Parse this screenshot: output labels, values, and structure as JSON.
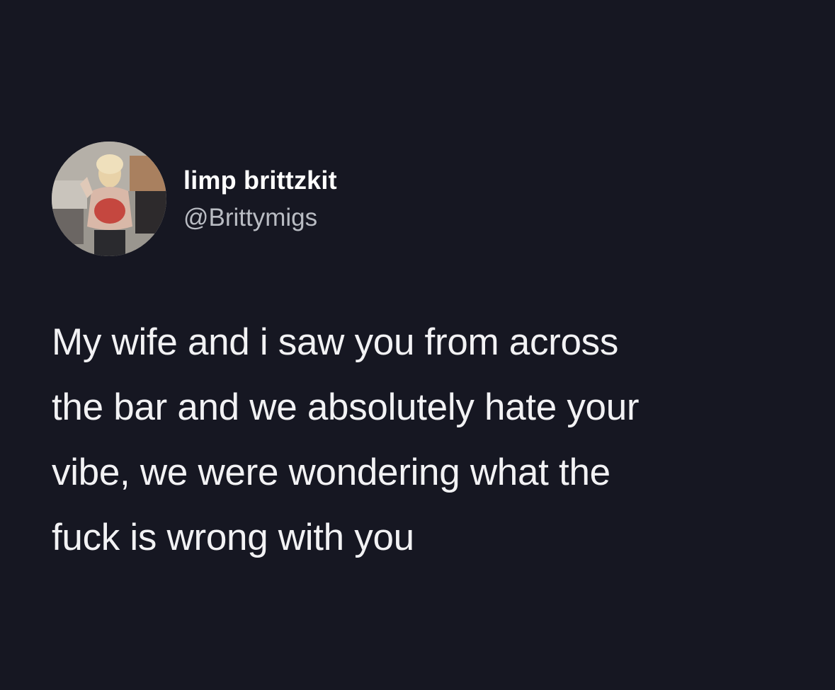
{
  "tweet": {
    "author": {
      "display_name": "limp brittzkit",
      "handle": "@Brittymigs",
      "avatar_icon": "profile-photo"
    },
    "text_lines": [
      "My wife and i saw you from across",
      "the bar and we absolutely hate your",
      "vibe, we were wondering what the",
      "fuck is wrong with you"
    ]
  },
  "colors": {
    "background": "#161722",
    "name": "#ffffff",
    "handle": "#b9bcc3",
    "text": "#f2f2f4"
  }
}
